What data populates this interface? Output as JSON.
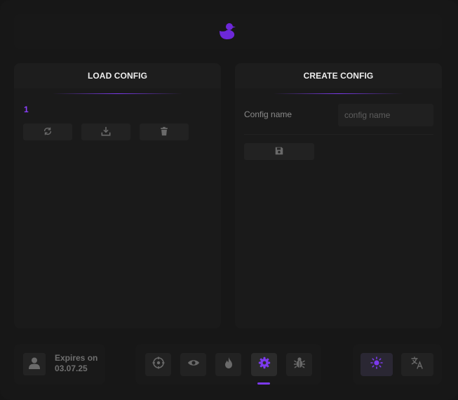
{
  "colors": {
    "accent": "#7c3aed",
    "accent_text": "#8b3fff",
    "icon": "#6a6a6a"
  },
  "logo": {
    "icon": "duck-icon"
  },
  "load_panel": {
    "title": "LOAD CONFIG",
    "configs": [
      "1"
    ],
    "buttons": [
      {
        "icon": "refresh-icon"
      },
      {
        "icon": "download-icon"
      },
      {
        "icon": "trash-icon"
      }
    ]
  },
  "create_panel": {
    "title": "CREATE CONFIG",
    "name_label": "Config name",
    "name_placeholder": "config name",
    "name_value": "",
    "save_icon": "floppy-icon"
  },
  "user": {
    "avatar_icon": "user-icon",
    "expires_label": "Expires on",
    "expires_date": "03.07.25"
  },
  "nav": {
    "active": "settings",
    "tabs": [
      {
        "id": "aim",
        "icon": "crosshair-icon"
      },
      {
        "id": "visuals",
        "icon": "eye-icon"
      },
      {
        "id": "fire",
        "icon": "flame-icon"
      },
      {
        "id": "settings",
        "icon": "gear-icon"
      },
      {
        "id": "debug",
        "icon": "bug-icon"
      }
    ]
  },
  "utility": [
    {
      "icon": "sun-icon",
      "active": true
    },
    {
      "icon": "translate-icon",
      "active": false
    }
  ]
}
